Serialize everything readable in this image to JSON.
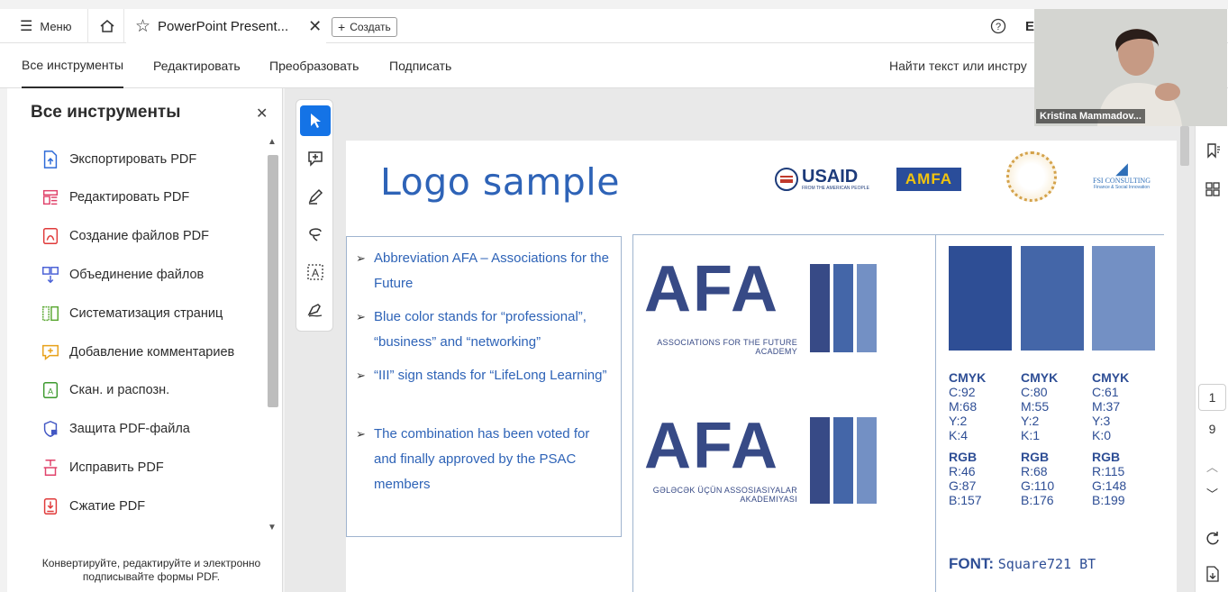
{
  "tabbar": {
    "menu_label": "Меню",
    "doc_tab_title": "PowerPoint Present...",
    "create_label": "Создать",
    "user_initial": "E"
  },
  "toolnav": {
    "tabs": [
      "Все инструменты",
      "Редактировать",
      "Преобразовать",
      "Подписать"
    ],
    "search_text": "Найти текст или инстру"
  },
  "sidebar": {
    "title": "Все инструменты",
    "items": [
      {
        "label": "Экспортировать PDF",
        "icon": "export-pdf-icon",
        "color": "#2d6ad8"
      },
      {
        "label": "Редактировать PDF",
        "icon": "edit-pdf-icon",
        "color": "#e0436b"
      },
      {
        "label": "Создание файлов PDF",
        "icon": "create-pdf-icon",
        "color": "#e03a3a"
      },
      {
        "label": "Объединение файлов",
        "icon": "combine-files-icon",
        "color": "#4a61d6"
      },
      {
        "label": "Систематизация страниц",
        "icon": "organize-pages-icon",
        "color": "#5aa832"
      },
      {
        "label": "Добавление комментариев",
        "icon": "comment-icon",
        "color": "#e8a11a"
      },
      {
        "label": "Скан. и распозн.",
        "icon": "scan-ocr-icon",
        "color": "#3c9a2e"
      },
      {
        "label": "Защита PDF-файла",
        "icon": "protect-pdf-icon",
        "color": "#4257c4"
      },
      {
        "label": "Исправить PDF",
        "icon": "redact-pdf-icon",
        "color": "#e0436b"
      },
      {
        "label": "Сжатие PDF",
        "icon": "compress-pdf-icon",
        "color": "#e03a3a"
      }
    ],
    "footer": "Конвертируйте, редактируйте и электронно подписывайте формы PDF."
  },
  "slide": {
    "title": "Logo sample",
    "bullets": [
      "Abbreviation AFA – Associations for the Future",
      "Blue color stands for “professional”, “business” and “networking”",
      "“III” sign stands for “LifeLong Learning”",
      "The combination has been voted for and finally approved by the PSAC members"
    ],
    "logo1": {
      "wordmark": "AFA",
      "sub1": "ASSOCIATIONS FOR THE FUTURE",
      "sub2": "ACADEMY"
    },
    "logo2": {
      "wordmark": "AFA",
      "sub1": "GƏLƏCƏK ÜÇÜN ASSOSIASIYALAR",
      "sub2": "AKADEMIYASI"
    },
    "swatches": [
      {
        "color": "#2e4e95",
        "cmyk_label": "CMYK",
        "c": "C:92",
        "m": "M:68",
        "y": "Y:2",
        "k": "K:4",
        "rgb_label": "RGB",
        "r": "R:46",
        "g": "G:87",
        "b": "B:157"
      },
      {
        "color": "#4466a8",
        "cmyk_label": "CMYK",
        "c": "C:80",
        "m": "M:55",
        "y": "Y:2",
        "k": "K:1",
        "rgb_label": "RGB",
        "r": "R:68",
        "g": "G:110",
        "b": "B:176"
      },
      {
        "color": "#7390c4",
        "cmyk_label": "CMYK",
        "c": "C:61",
        "m": "M:37",
        "y": "Y:3",
        "k": "K:0",
        "rgb_label": "RGB",
        "r": "R:115",
        "g": "G:148",
        "b": "B:199"
      }
    ],
    "font_label": "FONT:",
    "font_value": "Square721 BT",
    "partners": {
      "usaid": "USAID",
      "usaid_sub": "FROM THE AMERICAN PEOPLE",
      "amfa": "AMFA",
      "fsi": "FSI CONSULTING",
      "fsi_sub": "Finance & Social Innovation"
    }
  },
  "right_rail": {
    "page_current": "1",
    "page_total": "9"
  },
  "webcam": {
    "name": "Kristina Mammadov..."
  }
}
